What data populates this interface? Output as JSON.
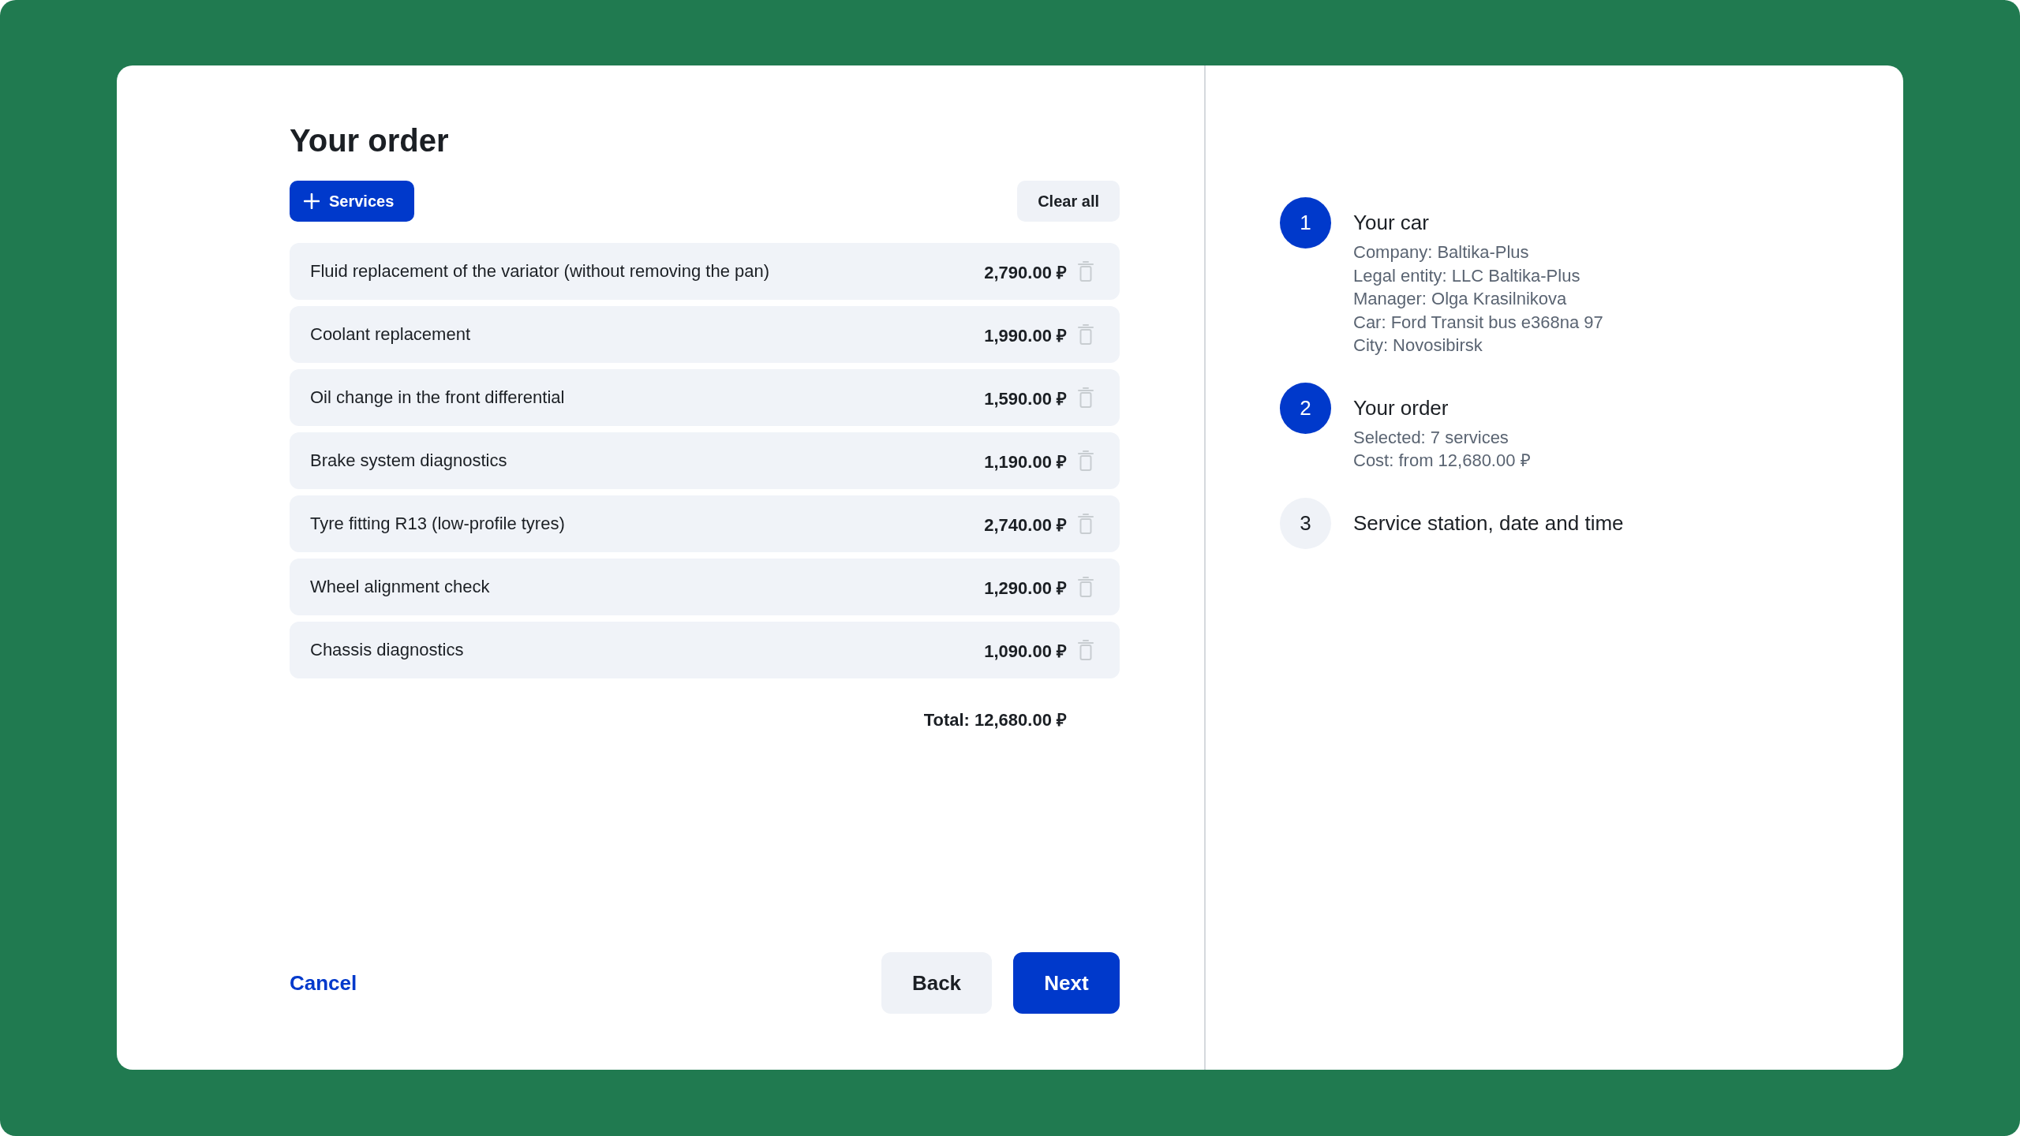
{
  "order": {
    "title": "Your order",
    "add_button": {
      "label": "Services"
    },
    "clear_button": {
      "label": "Clear all"
    },
    "services": [
      {
        "name": "Fluid replacement of the variator (without removing the pan)",
        "price": "2,790.00 ₽"
      },
      {
        "name": "Coolant replacement",
        "price": "1,990.00 ₽"
      },
      {
        "name": "Oil change in the front differential",
        "price": "1,590.00 ₽"
      },
      {
        "name": "Brake system diagnostics",
        "price": "1,190.00 ₽"
      },
      {
        "name": "Tyre fitting R13 (low-profile tyres)",
        "price": "2,740.00 ₽"
      },
      {
        "name": "Wheel alignment check",
        "price": "1,290.00 ₽"
      },
      {
        "name": "Chassis diagnostics",
        "price": "1,090.00 ₽"
      }
    ],
    "total": "Total: 12,680.00 ₽"
  },
  "actions": {
    "cancel": "Cancel",
    "back": "Back",
    "next": "Next"
  },
  "steps": [
    {
      "number": "1",
      "title": "Your car",
      "active": true,
      "details": [
        "Company: Baltika-Plus",
        "Legal entity: LLC Baltika-Plus",
        "Manager: Olga Krasilnikova",
        "Car: Ford Transit bus e368na 97",
        "City: Novosibirsk"
      ]
    },
    {
      "number": "2",
      "title": "Your order",
      "active": true,
      "details": [
        "Selected: 7 services",
        "Cost: from 12,680.00 ₽"
      ]
    },
    {
      "number": "3",
      "title": "Service station, date and time",
      "active": false
    }
  ]
}
